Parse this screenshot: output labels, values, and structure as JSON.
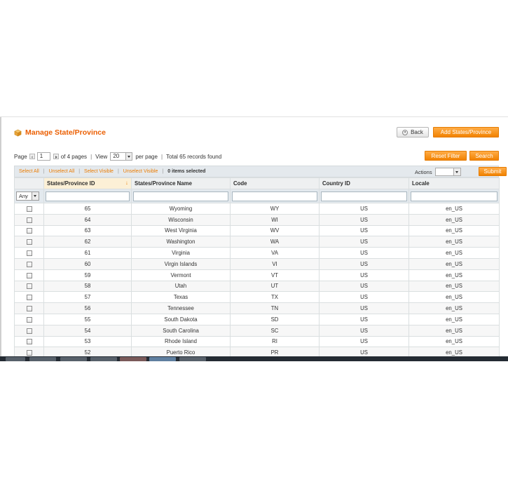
{
  "header": {
    "title": "Manage State/Province",
    "back_label": "Back",
    "add_label": "Add States/Province"
  },
  "pager": {
    "page_label": "Page",
    "current_page": "1",
    "of_pages": "of 4 pages",
    "view_label": "View",
    "per_page_value": "20",
    "per_page_label": "per page",
    "total": "Total 65 records found"
  },
  "grid_buttons": {
    "reset_label": "Reset Filter",
    "search_label": "Search"
  },
  "massaction": {
    "select_all": "Select All",
    "unselect_all": "Unselect All",
    "select_visible": "Select Visible",
    "unselect_visible": "Unselect Visible",
    "items_selected": "0 items selected",
    "actions_label": "Actions",
    "submit_label": "Submit"
  },
  "filter": {
    "any_label": "Any"
  },
  "columns": [
    "States/Province ID",
    "States/Province Name",
    "Code",
    "Country ID",
    "Locale"
  ],
  "sort_indicator": "↓",
  "rows": [
    {
      "id": "65",
      "name": "Wyoming",
      "code": "WY",
      "country": "US",
      "locale": "en_US"
    },
    {
      "id": "64",
      "name": "Wisconsin",
      "code": "WI",
      "country": "US",
      "locale": "en_US"
    },
    {
      "id": "63",
      "name": "West Virginia",
      "code": "WV",
      "country": "US",
      "locale": "en_US"
    },
    {
      "id": "62",
      "name": "Washington",
      "code": "WA",
      "country": "US",
      "locale": "en_US"
    },
    {
      "id": "61",
      "name": "Virginia",
      "code": "VA",
      "country": "US",
      "locale": "en_US"
    },
    {
      "id": "60",
      "name": "Virgin Islands",
      "code": "VI",
      "country": "US",
      "locale": "en_US"
    },
    {
      "id": "59",
      "name": "Vermont",
      "code": "VT",
      "country": "US",
      "locale": "en_US"
    },
    {
      "id": "58",
      "name": "Utah",
      "code": "UT",
      "country": "US",
      "locale": "en_US"
    },
    {
      "id": "57",
      "name": "Texas",
      "code": "TX",
      "country": "US",
      "locale": "en_US"
    },
    {
      "id": "56",
      "name": "Tennessee",
      "code": "TN",
      "country": "US",
      "locale": "en_US"
    },
    {
      "id": "55",
      "name": "South Dakota",
      "code": "SD",
      "country": "US",
      "locale": "en_US"
    },
    {
      "id": "54",
      "name": "South Carolina",
      "code": "SC",
      "country": "US",
      "locale": "en_US"
    },
    {
      "id": "53",
      "name": "Rhode Island",
      "code": "RI",
      "country": "US",
      "locale": "en_US"
    },
    {
      "id": "52",
      "name": "Puerto Rico",
      "code": "PR",
      "country": "US",
      "locale": "en_US"
    }
  ],
  "icons": {
    "header_icon": "box-icon",
    "back_icon": "circle-arrow-left-icon",
    "prev_icon": "arrow-left-icon",
    "next_icon": "arrow-right-icon",
    "dropdown_icon": "chevron-down-icon"
  },
  "colors": {
    "accent": "#eb5e00",
    "button_orange": "#f18200",
    "header_bg": "#eef0f1",
    "sorted_header_bg": "#fcf0d6",
    "massbar_bg": "#e4e9ed",
    "taskbar": "#242b33"
  }
}
